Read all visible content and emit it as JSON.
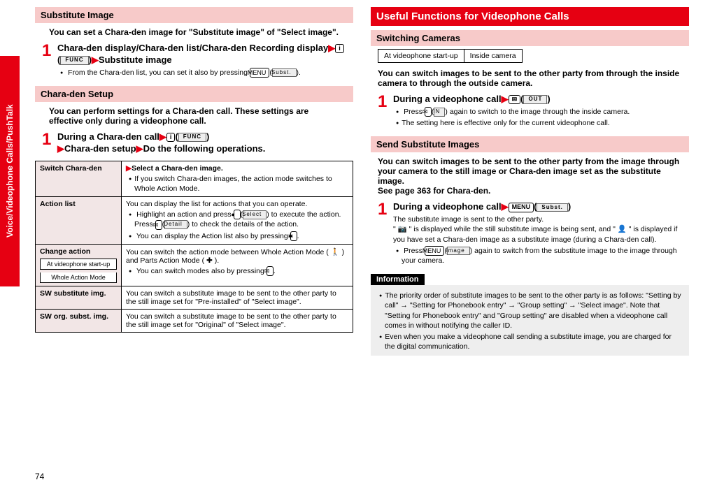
{
  "sideTab": "Voice/Videophone Calls/PushTalk",
  "pageNumber": "74",
  "left": {
    "section1": {
      "header": "Substitute Image",
      "desc": "You can set a Chara-den image for \"Substitute image\" of \"Select image\".",
      "step1Title": "Chara-den display/Chara-den list/Chara-den Recording display",
      "step1Suffix": "Substitute image",
      "keyFunc": "FUNC",
      "keySubst": "Subst.",
      "note1": "From the Chara-den list, you can set it also by pressing "
    },
    "section2": {
      "header": "Chara-den Setup",
      "desc": "You can perform settings for a Chara-den call. These settings are effective only during a videophone call.",
      "step1Title": "During a Chara-den call",
      "step1Line2a": "Chara-den setup",
      "step1Line2b": "Do the following operations.",
      "table": {
        "r1Label": "Switch Chara-den",
        "r1SelectPrefix": "Select a Chara-den image.",
        "r1Bullet": "If you switch Chara-den images, the action mode switches to Whole Action Mode.",
        "r2Label": "Action list",
        "r2Desc": "You can display the list for actions that you can operate.",
        "r2Bullet1a": "Highlight an action and press ",
        "r2Bullet1Select": "Select",
        "r2Bullet1b": " to execute the action. Press ",
        "r2Bullet1Detail": "Detail",
        "r2Bullet1c": " to check the details of the action.",
        "r2Bullet2": "You can display the Action list also by pressing ",
        "r3Label": "Change action",
        "r3Sub1": "At videophone start-up",
        "r3Sub2": "Whole Action Mode",
        "r3Desc": "You can switch the action mode between Whole Action Mode ( 🚶 ) and Parts Action Mode ( ✚ ).",
        "r3Bullet": "You can switch modes also by pressing ",
        "r4Label": "SW substitute img.",
        "r4Desc": "You can switch a substitute image to be sent to the other party to the still image set for \"Pre-installed\" of \"Select image\".",
        "r5Label": "SW org. subst. img.",
        "r5Desc": "You can switch a substitute image to be sent to the other party to the still image set for \"Original\" of \"Select image\"."
      }
    }
  },
  "right": {
    "mainHeader": "Useful Functions for Videophone Calls",
    "section1": {
      "header": "Switching Cameras",
      "camLabel": "At videophone start-up",
      "camValue": "Inside camera",
      "desc": "You can switch images to be sent to the other party from through the inside camera to through the outside camera.",
      "step1Title": "During a videophone call",
      "keyOut": "OUT",
      "keyIn": "IN",
      "bullet1a": "Press ",
      "bullet1b": " again to switch to the image through the inside camera.",
      "bullet2": "The setting here is effective only for the current videophone call."
    },
    "section2": {
      "header": "Send Substitute Images",
      "desc": "You can switch images to be sent to the other party from the image through your camera to the still image or Chara-den image set as the substitute image.",
      "seePage": "See page 363 for Chara-den.",
      "step1Title": "During a videophone call",
      "keySubst": "Subst.",
      "keyImage": "image",
      "subDesc1": "The substitute image is sent to the other party.",
      "subDesc2a": "\" 📷 \" is displayed while the still substitute image is being sent, and \" 👤 \" is displayed if you have set a Chara-den image as a substitute image (during a Chara-den call).",
      "bullet1a": "Press ",
      "bullet1b": " again to switch from the substitute image to the image through your camera."
    },
    "info": {
      "header": "Information",
      "bullet1": "The priority order of substitute images to be sent to the other party is as follows: \"Setting by call\" → \"Setting for Phonebook entry\" → \"Group setting\" → \"Select image\". Note that \"Setting for Phonebook entry\" and \"Group setting\" are disabled when a videophone call comes in without notifying the caller ID.",
      "bullet2": "Even when you make a videophone call sending a substitute image, you are charged for the digital communication."
    }
  }
}
